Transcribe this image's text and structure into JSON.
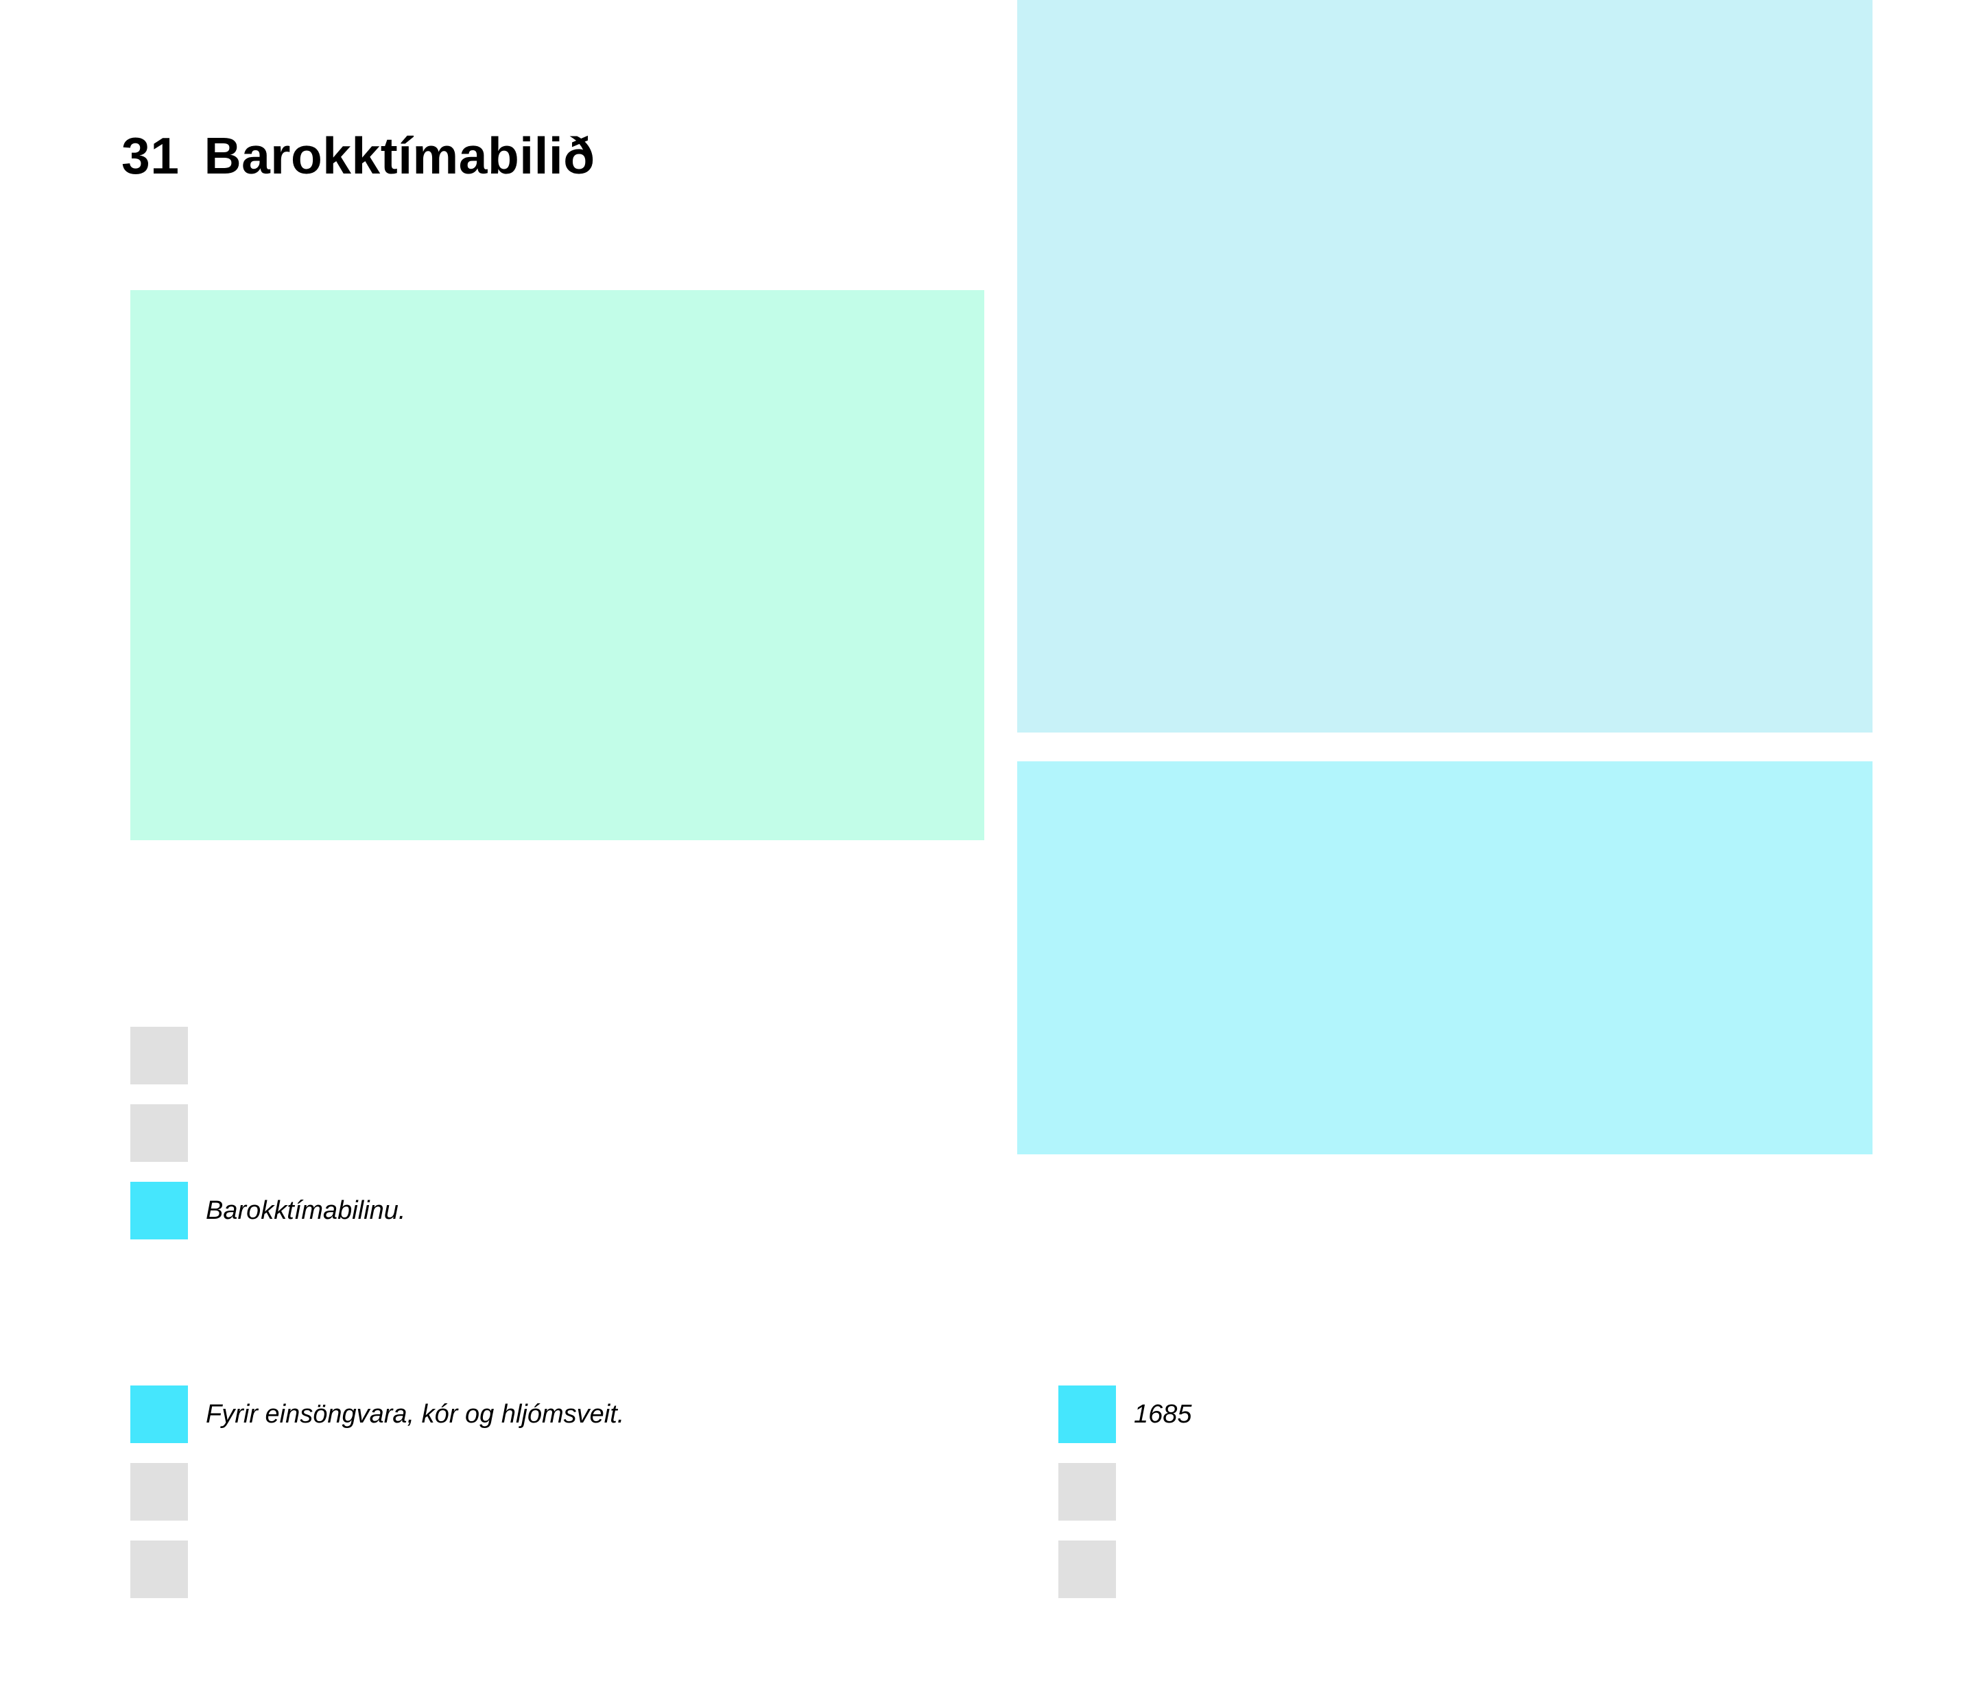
{
  "colors": {
    "background": "#ffffff",
    "panel_green": "#c2fde8",
    "panel_light_cyan": "#c8f2f8",
    "panel_cyan": "#b2f5fc",
    "option_selected": "#45e6fd",
    "option_unselected": "#e0e0e0",
    "text": "#000000"
  },
  "header": {
    "number": "31",
    "title": "Barokktímabilið"
  },
  "panels": [
    {
      "name": "image-panel-left",
      "color": "#c2fde8"
    },
    {
      "name": "image-panel-right-top",
      "color": "#c8f2f8"
    },
    {
      "name": "image-panel-right-bottom",
      "color": "#b2f5fc"
    }
  ],
  "question_period": {
    "options": [
      {
        "label": "",
        "selected": false
      },
      {
        "label": "",
        "selected": false
      },
      {
        "label": "Barokktímabilinu.",
        "selected": true
      }
    ]
  },
  "question_type": {
    "options": [
      {
        "label": "Fyrir einsöngvara, kór og hljómsveit.",
        "selected": true
      },
      {
        "label": "",
        "selected": false
      },
      {
        "label": "",
        "selected": false
      }
    ]
  },
  "question_year": {
    "options": [
      {
        "label": "1685",
        "selected": true
      },
      {
        "label": "",
        "selected": false
      },
      {
        "label": "",
        "selected": false
      }
    ]
  }
}
